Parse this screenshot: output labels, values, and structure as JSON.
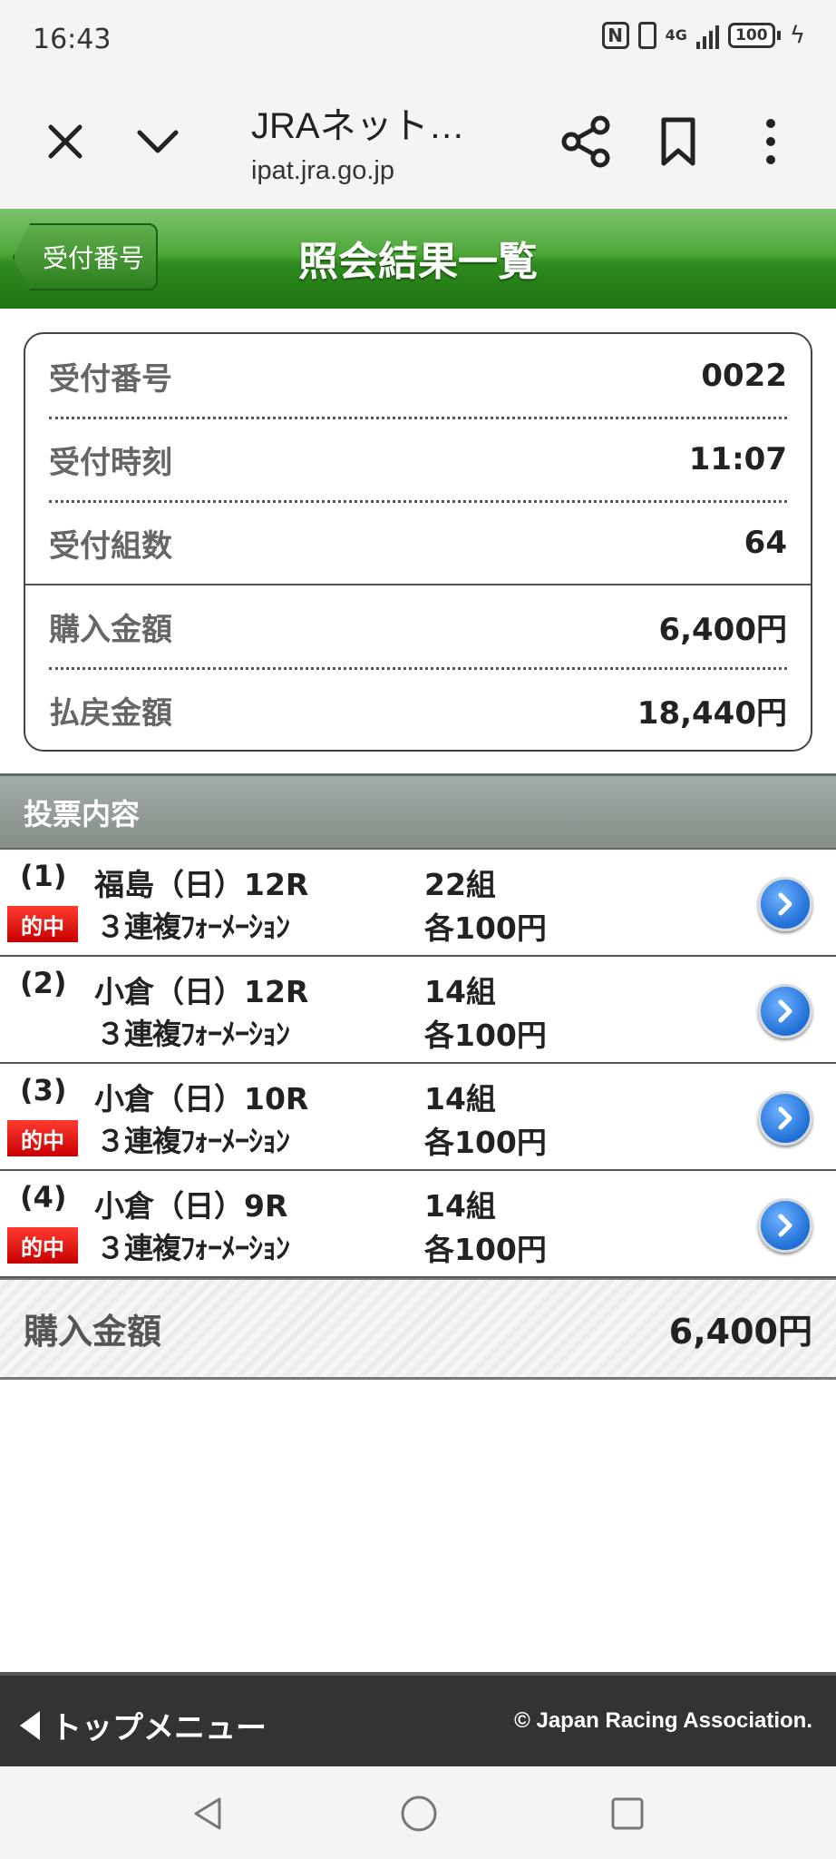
{
  "status_bar": {
    "time": "16:43",
    "nfc": "N",
    "network": "4G",
    "battery": "100"
  },
  "browser": {
    "title": "JRAネット…",
    "url": "ipat.jra.go.jp"
  },
  "header": {
    "back_label": "受付番号",
    "title": "照会結果一覧"
  },
  "summary": {
    "receipt_number_label": "受付番号",
    "receipt_number": "0022",
    "receipt_time_label": "受付時刻",
    "receipt_time": "11:07",
    "set_count_label": "受付組数",
    "set_count": "64",
    "purchase_label": "購入金額",
    "purchase_amount": "6,400円",
    "payout_label": "払戻金額",
    "payout_amount": "18,440円"
  },
  "section_title": "投票内容",
  "hit_badge": "的中",
  "bets": [
    {
      "num": "(1)",
      "race": "福島（日）12R",
      "count": "22組",
      "type": "３連複ﾌｫｰﾒｰｼｮﾝ",
      "amount": "各100円",
      "hit": true
    },
    {
      "num": "(2)",
      "race": "小倉（日）12R",
      "count": "14組",
      "type": "３連複ﾌｫｰﾒｰｼｮﾝ",
      "amount": "各100円",
      "hit": false
    },
    {
      "num": "(3)",
      "race": "小倉（日）10R",
      "count": "14組",
      "type": "３連複ﾌｫｰﾒｰｼｮﾝ",
      "amount": "各100円",
      "hit": true
    },
    {
      "num": "(4)",
      "race": "小倉（日）9R",
      "count": "14組",
      "type": "３連複ﾌｫｰﾒｰｼｮﾝ",
      "amount": "各100円",
      "hit": true
    }
  ],
  "total": {
    "label": "購入金額",
    "amount": "6,400円"
  },
  "footer": {
    "menu_label": "トップメニュー",
    "copyright": "© Japan Racing Association."
  },
  "colors": {
    "header_green": "#2e8a1d",
    "hit_red": "#d90000",
    "arrow_blue": "#1f6fd6",
    "footer_dark": "#333333"
  }
}
